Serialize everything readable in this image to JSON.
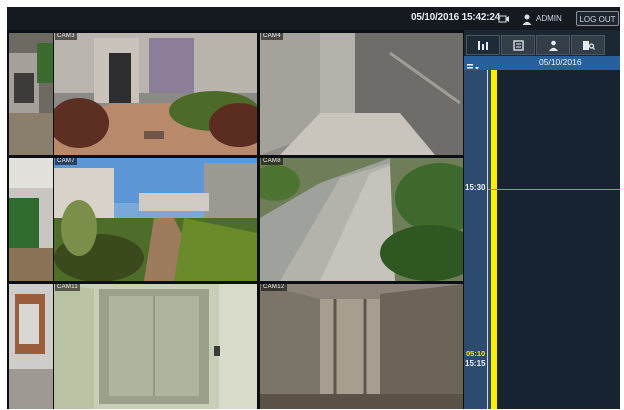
{
  "header": {
    "datetime": "05/10/2016 15:42:24",
    "user": "ADMIN",
    "logout_label": "LOG OUT"
  },
  "cameras": [
    {
      "label": "CAM3",
      "scene": "courtyard with hedges and entrance"
    },
    {
      "label": "CAM4",
      "scene": "elevator interior"
    },
    {
      "label": "CAM7",
      "scene": "apartment complex garden"
    },
    {
      "label": "CAM8",
      "scene": "walkway beside hedges"
    },
    {
      "label": "CAM11",
      "scene": "elevator lobby"
    },
    {
      "label": "CAM12",
      "scene": "elevator interior"
    }
  ],
  "side_panel": {
    "tabs": [
      "timeline-icon",
      "list-icon",
      "person-icon",
      "search-person-icon"
    ],
    "date": "05/10/2016",
    "timeline": {
      "tick_labels": [
        "15:30",
        "15:15"
      ],
      "cursor_time": "05:10"
    }
  },
  "colors": {
    "accent_blue": "#27609d",
    "record_bar": "#ffef00",
    "cursor": "#2fd52f",
    "background": "#0b0f14"
  }
}
